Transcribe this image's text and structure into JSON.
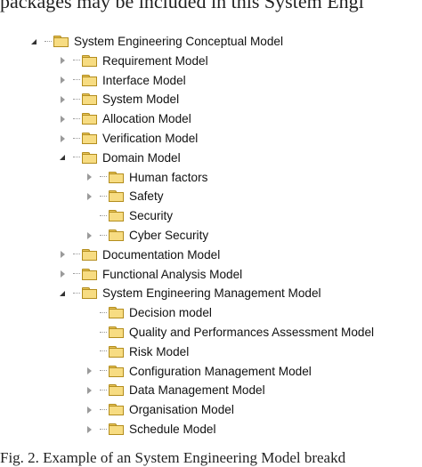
{
  "header_text": "packages may be included in this System Engi",
  "caption": "Fig. 2.   Example of an System Engineering Model breakd",
  "tree": [
    {
      "label": "System Engineering Conceptual Model",
      "level": 0,
      "toggle": "expanded"
    },
    {
      "label": "Requirement Model",
      "level": 1,
      "toggle": "collapsed"
    },
    {
      "label": "Interface Model",
      "level": 1,
      "toggle": "collapsed"
    },
    {
      "label": "System Model",
      "level": 1,
      "toggle": "collapsed"
    },
    {
      "label": "Allocation Model",
      "level": 1,
      "toggle": "collapsed"
    },
    {
      "label": "Verification Model",
      "level": 1,
      "toggle": "collapsed"
    },
    {
      "label": "Domain Model",
      "level": 1,
      "toggle": "expanded"
    },
    {
      "label": "Human factors",
      "level": 2,
      "toggle": "collapsed"
    },
    {
      "label": "Safety",
      "level": 2,
      "toggle": "collapsed"
    },
    {
      "label": "Security",
      "level": 2,
      "toggle": "none"
    },
    {
      "label": "Cyber Security",
      "level": 2,
      "toggle": "collapsed"
    },
    {
      "label": "Documentation Model",
      "level": 1,
      "toggle": "collapsed"
    },
    {
      "label": "Functional Analysis Model",
      "level": 1,
      "toggle": "collapsed"
    },
    {
      "label": "System Engineering Management Model",
      "level": 1,
      "toggle": "expanded"
    },
    {
      "label": "Decision model",
      "level": 2,
      "toggle": "none"
    },
    {
      "label": "Quality and Performances Assessment Model",
      "level": 2,
      "toggle": "none"
    },
    {
      "label": "Risk Model",
      "level": 2,
      "toggle": "none"
    },
    {
      "label": "Configuration Management Model",
      "level": 2,
      "toggle": "collapsed"
    },
    {
      "label": "Data Management Model",
      "level": 2,
      "toggle": "collapsed"
    },
    {
      "label": "Organisation Model",
      "level": 2,
      "toggle": "collapsed"
    },
    {
      "label": "Schedule Model",
      "level": 2,
      "toggle": "collapsed"
    }
  ]
}
